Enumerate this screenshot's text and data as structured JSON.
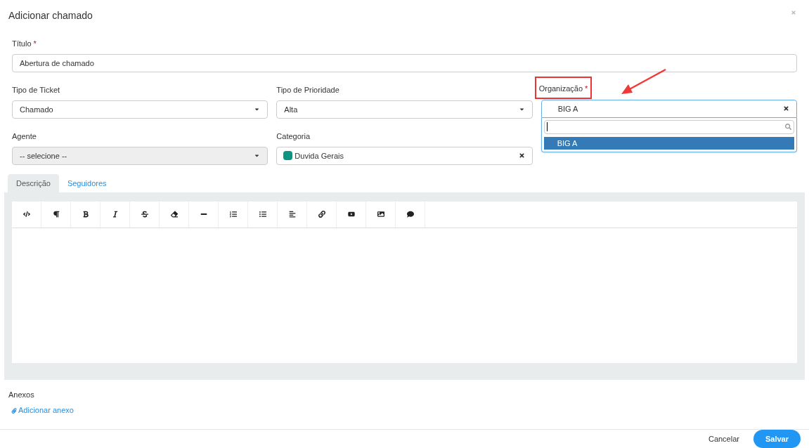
{
  "dialog": {
    "title": "Adicionar chamado"
  },
  "title_field": {
    "label": "Título",
    "required_mark": "*",
    "value": "Abertura de chamado"
  },
  "fields": [
    {
      "kind": "select",
      "label": "Tipo de Ticket",
      "value": "Chamado",
      "disabled": false
    },
    {
      "kind": "select",
      "label": "Tipo de Prioridade",
      "value": "Alta",
      "disabled": false
    },
    {
      "kind": "clearable",
      "label": "Organização",
      "required_mark": "*",
      "highlighted": true,
      "value": "BIG A",
      "expanded": true,
      "options": [
        {
          "label": "BIG A",
          "selected": true
        }
      ]
    },
    {
      "kind": "select",
      "label": "Agente",
      "value": "-- selecione --",
      "disabled": true
    },
    {
      "kind": "color-tag",
      "label": "Categoria",
      "value": "Duvida Gerais",
      "color": "#0e9582"
    }
  ],
  "tabs": [
    {
      "label": "Descrição",
      "selected": true
    },
    {
      "label": "Seguidores",
      "selected": false
    }
  ],
  "attachments": {
    "heading": "Anexos",
    "link": "Adicionar anexo"
  },
  "buttons": [
    {
      "label": "Cancelar",
      "kind": "secondary"
    },
    {
      "label": "Salvar",
      "kind": "primary"
    }
  ]
}
